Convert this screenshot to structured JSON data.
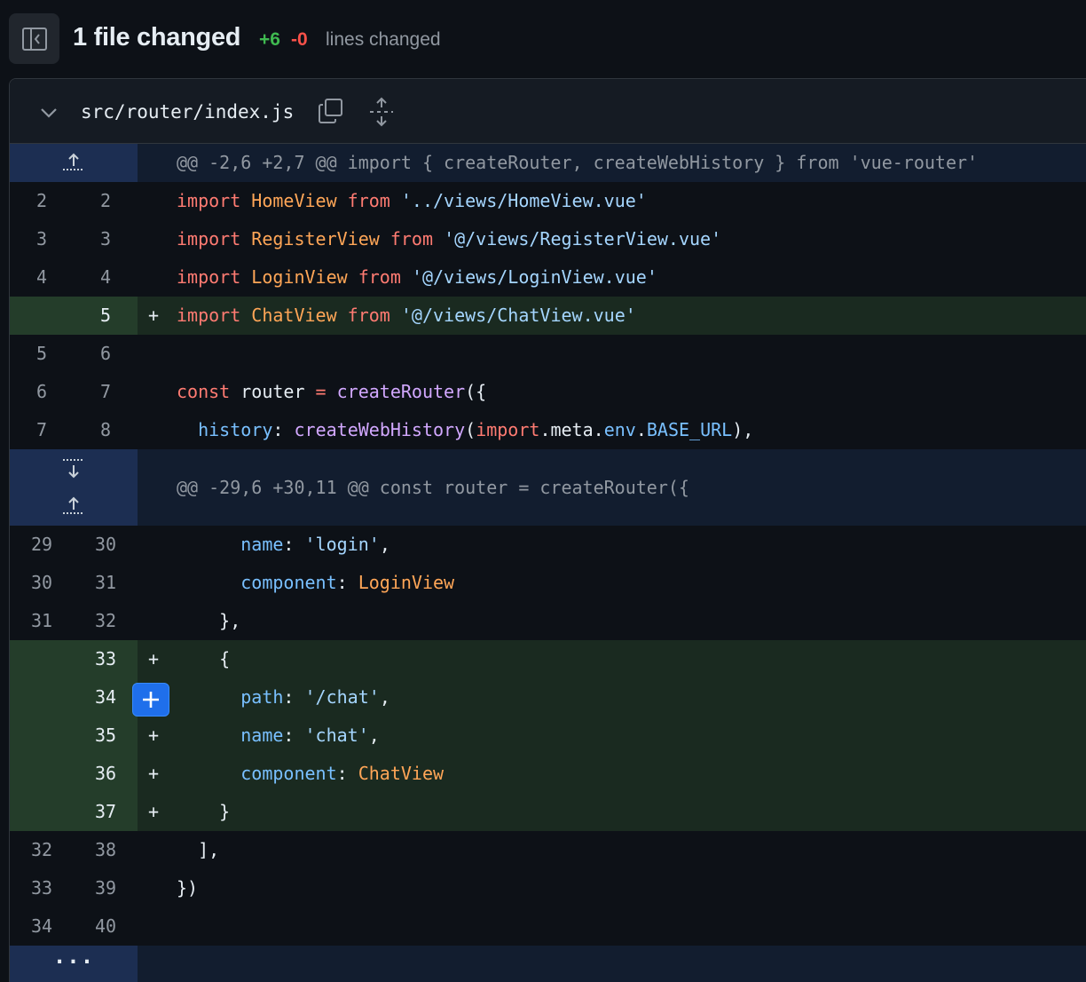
{
  "summary": {
    "title": "1 file changed",
    "additions": "+6",
    "deletions": "-0",
    "lines_label": "lines changed"
  },
  "file": {
    "path": "src/router/index.js"
  },
  "hunks": [
    {
      "header": "@@ -2,6 +2,7 @@ import { createRouter, createWebHistory } from 'vue-router'"
    },
    {
      "header": "@@ -29,6 +30,11 @@ const router = createRouter({"
    }
  ],
  "lines": [
    {
      "old": "2",
      "new": "2",
      "marker": "",
      "text": "import HomeView from '../views/HomeView.vue'"
    },
    {
      "old": "3",
      "new": "3",
      "marker": "",
      "text": "import RegisterView from '@/views/RegisterView.vue'"
    },
    {
      "old": "4",
      "new": "4",
      "marker": "",
      "text": "import LoginView from '@/views/LoginView.vue'"
    },
    {
      "old": "",
      "new": "5",
      "marker": "+",
      "text": "import ChatView from '@/views/ChatView.vue'"
    },
    {
      "old": "5",
      "new": "6",
      "marker": "",
      "text": ""
    },
    {
      "old": "6",
      "new": "7",
      "marker": "",
      "text": "const router = createRouter({"
    },
    {
      "old": "7",
      "new": "8",
      "marker": "",
      "text": "  history: createWebHistory(import.meta.env.BASE_URL),"
    },
    {
      "old": "29",
      "new": "30",
      "marker": "",
      "text": "      name: 'login',"
    },
    {
      "old": "30",
      "new": "31",
      "marker": "",
      "text": "      component: LoginView"
    },
    {
      "old": "31",
      "new": "32",
      "marker": "",
      "text": "    },"
    },
    {
      "old": "",
      "new": "33",
      "marker": "+",
      "text": "    {"
    },
    {
      "old": "",
      "new": "34",
      "marker": "+",
      "text": "      path: '/chat',"
    },
    {
      "old": "",
      "new": "35",
      "marker": "+",
      "text": "      name: 'chat',"
    },
    {
      "old": "",
      "new": "36",
      "marker": "+",
      "text": "      component: ChatView"
    },
    {
      "old": "",
      "new": "37",
      "marker": "+",
      "text": "    }"
    },
    {
      "old": "32",
      "new": "38",
      "marker": "",
      "text": "  ],"
    },
    {
      "old": "33",
      "new": "39",
      "marker": "",
      "text": "})"
    },
    {
      "old": "34",
      "new": "40",
      "marker": "",
      "text": ""
    }
  ],
  "more_label": "···",
  "colors": {
    "added_bg": "#1a2a20",
    "hunk_bg": "#121d2f",
    "accent": "#1f6feb"
  }
}
